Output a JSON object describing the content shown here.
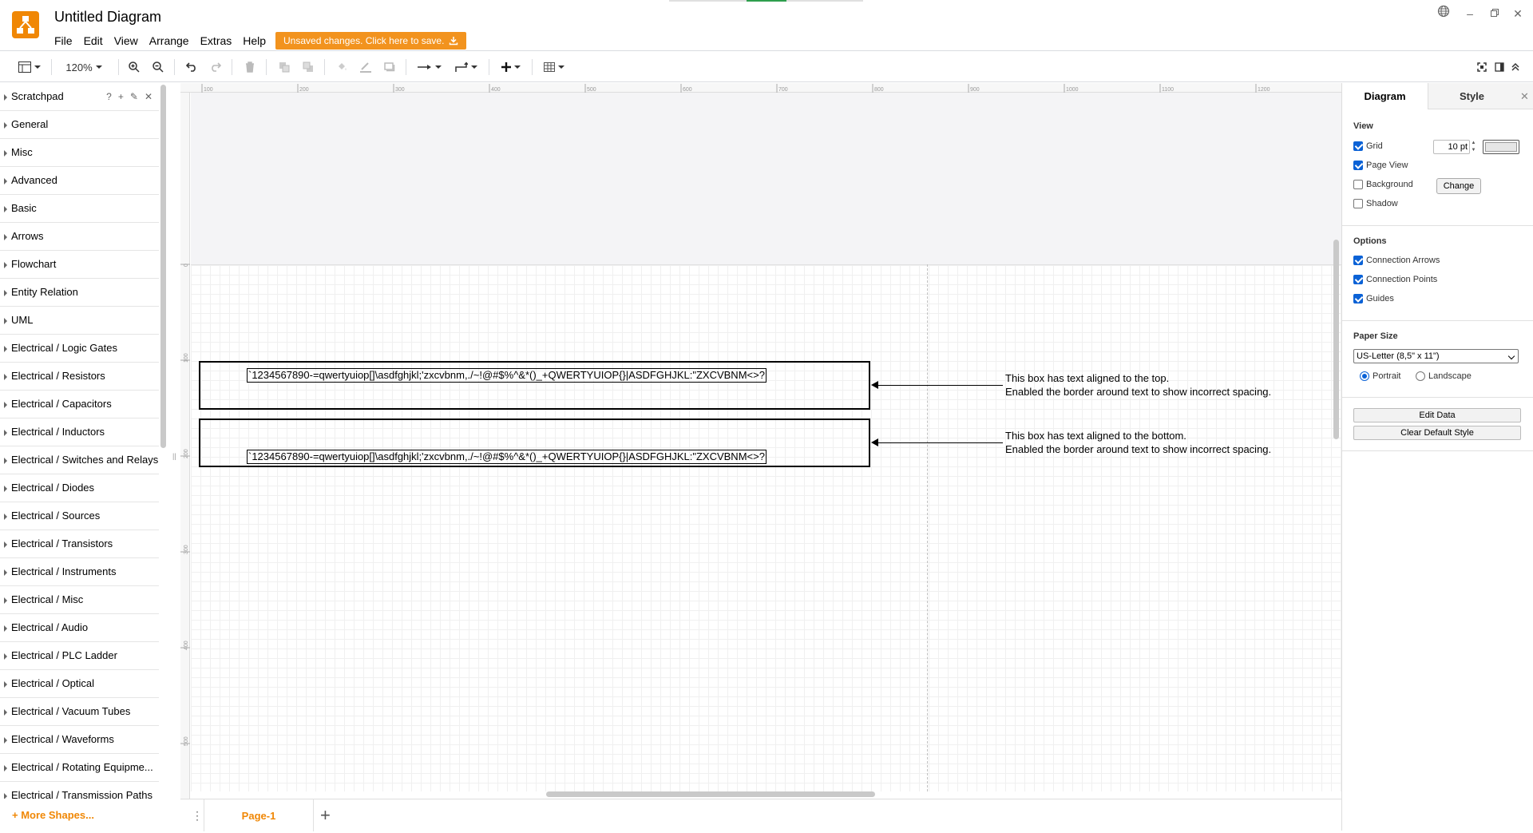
{
  "app": {
    "title": "Untitled Diagram",
    "menu": [
      "File",
      "Edit",
      "View",
      "Arrange",
      "Extras",
      "Help"
    ],
    "unsaved_notice": "Unsaved changes. Click here to save."
  },
  "toolbar": {
    "zoom": "120%"
  },
  "sidebar": {
    "libraries": [
      "Scratchpad",
      "General",
      "Misc",
      "Advanced",
      "Basic",
      "Arrows",
      "Flowchart",
      "Entity Relation",
      "UML",
      "Electrical / Logic Gates",
      "Electrical / Resistors",
      "Electrical / Capacitors",
      "Electrical / Inductors",
      "Electrical / Switches and Relays",
      "Electrical / Diodes",
      "Electrical / Sources",
      "Electrical / Transistors",
      "Electrical / Instruments",
      "Electrical / Misc",
      "Electrical / Audio",
      "Electrical / PLC Ladder",
      "Electrical / Optical",
      "Electrical / Vacuum Tubes",
      "Electrical / Waveforms",
      "Electrical / Rotating Equipme...",
      "Electrical / Transmission Paths"
    ],
    "scratchpad_help": "?",
    "more_shapes": "+ More Shapes..."
  },
  "rulers": {
    "top": [
      "100",
      "200",
      "300",
      "400",
      "500",
      "600",
      "700",
      "800",
      "900",
      "1000",
      "1100",
      "1200"
    ],
    "left": [
      "0",
      "100",
      "200",
      "300",
      "400",
      "500"
    ]
  },
  "canvas": {
    "box1_text": "`1234567890-=qwertyuiop[]\\asdfghjkl;'zxcvbnm,./~!@#$%^&*()_+QWERTYUIOP{}|ASDFGHJKL:\"ZXCVBNM<>?",
    "box2_text": "`1234567890-=qwertyuiop[]\\asdfghjkl;'zxcvbnm,./~!@#$%^&*()_+QWERTYUIOP{}|ASDFGHJKL:\"ZXCVBNM<>?",
    "note1_line1": "This box has text aligned to the top.",
    "note1_line2": "Enabled the border around text to show incorrect spacing.",
    "note2_line1": "This box has text aligned to the bottom.",
    "note2_line2": "Enabled the border around text to show incorrect spacing."
  },
  "pages": {
    "tabs": [
      "Page-1"
    ]
  },
  "format_panel": {
    "tabs": [
      "Diagram",
      "Style"
    ],
    "view_heading": "View",
    "grid_label": "Grid",
    "grid_checked": true,
    "grid_size": "10 pt",
    "page_view_label": "Page View",
    "page_view_checked": true,
    "background_label": "Background",
    "background_checked": false,
    "change_button": "Change",
    "shadow_label": "Shadow",
    "shadow_checked": false,
    "options_heading": "Options",
    "connection_arrows_label": "Connection Arrows",
    "connection_points_label": "Connection Points",
    "guides_label": "Guides",
    "paper_size_heading": "Paper Size",
    "paper_size_value": "US-Letter (8,5\" x 11\")",
    "portrait_label": "Portrait",
    "landscape_label": "Landscape",
    "orientation": "Portrait",
    "edit_data_button": "Edit Data",
    "clear_default_style_button": "Clear Default Style"
  },
  "colors": {
    "brand": "#f08705",
    "unsaved_bg": "#f2931e",
    "checkbox": "#0b62d6"
  },
  "icons": [
    "logo-icon",
    "globe-icon",
    "minimize-icon",
    "restore-icon",
    "close-icon",
    "format-panel-icon",
    "zoom-in-icon",
    "zoom-out-icon",
    "undo-icon",
    "redo-icon",
    "delete-icon",
    "to-front-icon",
    "to-back-icon",
    "fill-color-icon",
    "line-color-icon",
    "shadow-icon",
    "connection-icon",
    "waypoints-icon",
    "insert-icon",
    "table-icon",
    "fullscreen-icon",
    "toggle-panel-icon",
    "collapse-icon",
    "pages-menu-icon",
    "add-page-icon"
  ]
}
